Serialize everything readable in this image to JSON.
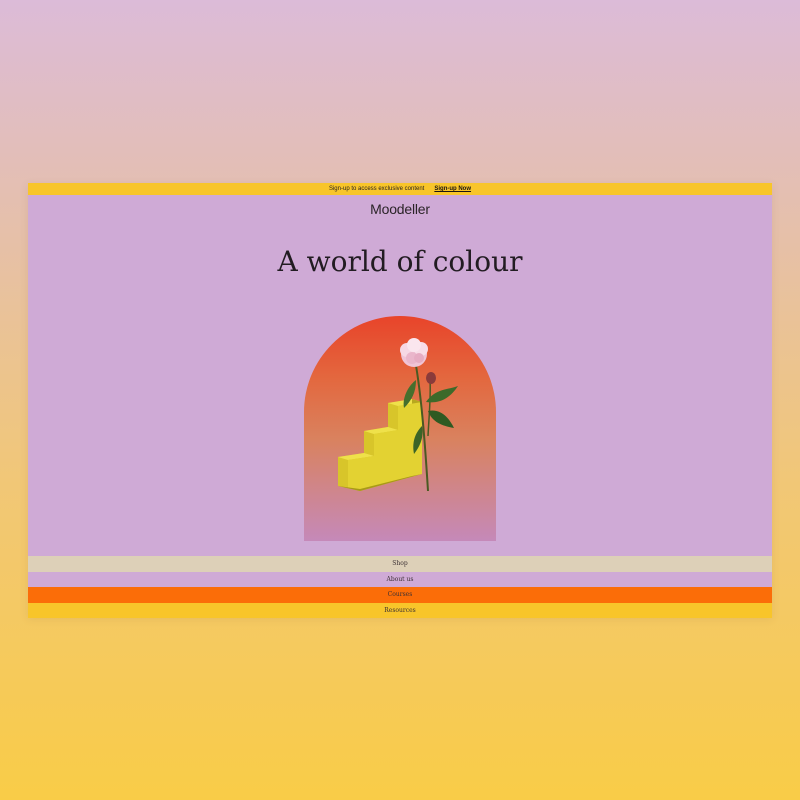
{
  "banner": {
    "text": "Sign-up to access exclusive content",
    "link_label": "Sign-up Now"
  },
  "logo": {
    "text": "Moodeller"
  },
  "hero": {
    "title": "A world of colour"
  },
  "menu": {
    "items": [
      {
        "label": "Shop",
        "color": "#ddd0b8"
      },
      {
        "label": "About us",
        "color": "#cfaad6"
      },
      {
        "label": "Courses",
        "color": "#fb6d08"
      },
      {
        "label": "Resources",
        "color": "#f8c52a"
      }
    ]
  },
  "colors": {
    "page_background_top": "#dcbbd8",
    "page_background_bottom": "#f9cc47",
    "frame_background": "#cfaad6",
    "banner_background": "#f8c52a",
    "arch_top": "#e8442a",
    "arch_bottom": "#c589b9",
    "stairs": "#d8c52a",
    "flower": "#f0c4d6"
  }
}
